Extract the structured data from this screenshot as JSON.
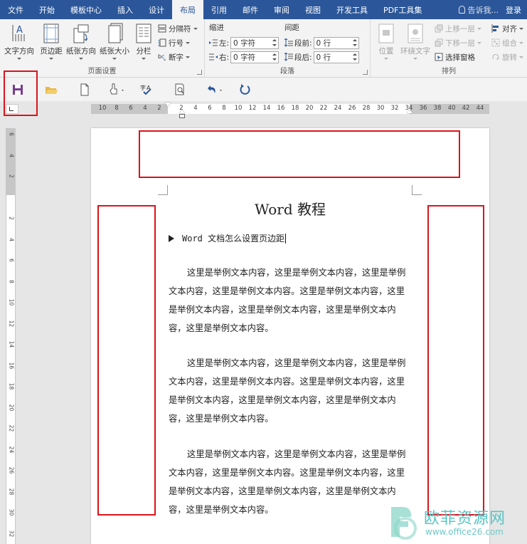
{
  "tabs": [
    {
      "label": "文件",
      "active": false
    },
    {
      "label": "开始",
      "active": false
    },
    {
      "label": "模板中心",
      "active": false
    },
    {
      "label": "插入",
      "active": false
    },
    {
      "label": "设计",
      "active": false
    },
    {
      "label": "布局",
      "active": true
    },
    {
      "label": "引用",
      "active": false
    },
    {
      "label": "邮件",
      "active": false
    },
    {
      "label": "审阅",
      "active": false
    },
    {
      "label": "视图",
      "active": false
    },
    {
      "label": "开发工具",
      "active": false
    },
    {
      "label": "PDF工具集",
      "active": false
    }
  ],
  "tell_me": "告诉我...",
  "login": "登录",
  "ribbon": {
    "page_setup": {
      "label": "页面设置",
      "text_direction": "文字方向",
      "margins": "页边距",
      "orientation": "纸张方向",
      "size": "纸张大小",
      "columns": "分栏",
      "breaks": "分隔符",
      "line_numbers": "行号",
      "hyphenation": "断字"
    },
    "paragraph": {
      "label": "段落",
      "indent_label": "缩进",
      "spacing_label": "间距",
      "left_label": "左:",
      "right_label": "右:",
      "before_label": "段前:",
      "after_label": "段后:",
      "indent_left": "0 字符",
      "indent_right": "0 字符",
      "space_before": "0 行",
      "space_after": "0 行"
    },
    "arrange": {
      "label": "排列",
      "position": "位置",
      "wrap_text": "环绕文字",
      "bring_forward": "上移一层",
      "send_backward": "下移一层",
      "selection_pane": "选择窗格",
      "align": "对齐",
      "group": "组合",
      "rotate": "旋转"
    }
  },
  "ruler": {
    "left_numbers": [
      "10",
      "8",
      "6",
      "4",
      "2"
    ],
    "right_numbers": [
      "2",
      "4",
      "6",
      "8",
      "10",
      "12",
      "14",
      "16",
      "18",
      "20",
      "22",
      "24",
      "26",
      "28",
      "30",
      "32",
      "34",
      "36",
      "38",
      "40",
      "42",
      "44"
    ],
    "vertical_numbers": [
      "6",
      "4",
      "2",
      "",
      "2",
      "4",
      "6",
      "8",
      "10",
      "12",
      "14",
      "16",
      "18",
      "20",
      "22",
      "24",
      "26",
      "28",
      "30",
      "32"
    ]
  },
  "document": {
    "title": "Word 教程",
    "bullet": "Word 文档怎么设置页边距",
    "paragraphs": [
      "这里是举例文本内容，这里是举例文本内容，这里是举例文本内容，这里是举例文本内容。这里是举例文本内容，这里是举例文本内容，这里是举例文本内容，这里是举例文本内容，这里是举例文本内容。",
      "这里是举例文本内容，这里是举例文本内容，这里是举例文本内容，这里是举例文本内容。这里是举例文本内容，这里是举例文本内容，这里是举例文本内容，这里是举例文本内容，这里是举例文本内容。",
      "这里是举例文本内容，这里是举例文本内容，这里是举例文本内容，这里是举例文本内容。这里是举例文本内容，这里是举例文本内容，这里是举例文本内容，这里是举例文本内容，这里是举例文本内容。"
    ]
  },
  "watermark": {
    "text": "欧菲资源网",
    "url": "www.office26.com"
  },
  "colors": {
    "accent": "#2b579a",
    "highlight": "#d9141c",
    "watermark": "#58c4c4"
  }
}
